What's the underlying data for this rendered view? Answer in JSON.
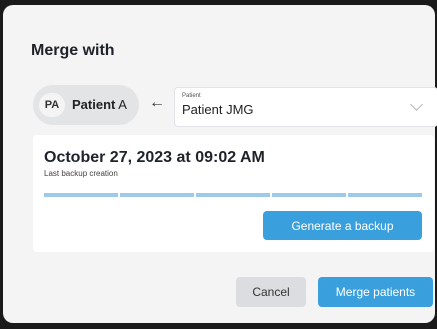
{
  "dialog": {
    "title": "Merge with"
  },
  "source_patient": {
    "initials": "PA",
    "name_bold": "Patient",
    "name_rest": " A"
  },
  "target_select": {
    "caption": "Patient",
    "value": "Patient JMG"
  },
  "backup": {
    "date": "October 27, 2023 at 09:02 AM",
    "caption": "Last backup creation",
    "progress_segments": 5,
    "generate_label": "Generate a backup"
  },
  "footer": {
    "cancel_label": "Cancel",
    "merge_label": "Merge patients"
  },
  "colors": {
    "accent": "#3aa0dd",
    "progress": "#9ccaea",
    "backdrop": "#1a1a1a",
    "dialog_bg": "#f4f4f5"
  },
  "icons": {
    "arrow": "left-arrow-icon",
    "chevron": "chevron-down-icon"
  }
}
